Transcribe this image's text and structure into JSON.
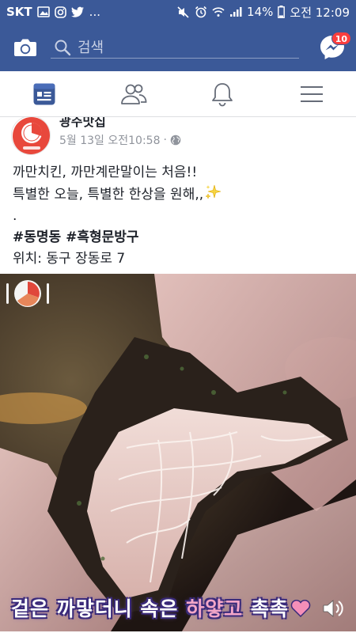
{
  "status_bar": {
    "carrier": "SKT",
    "more": "...",
    "battery": "14%",
    "time": "오전 12:09"
  },
  "header": {
    "search_placeholder": "검색",
    "messenger_badge": "10",
    "brand_color": "#3b5998"
  },
  "tabs": [
    {
      "name": "news-feed",
      "icon": "news-feed-icon",
      "active": true
    },
    {
      "name": "friends",
      "icon": "friends-icon",
      "active": false
    },
    {
      "name": "notifications",
      "icon": "bell-icon",
      "active": false
    },
    {
      "name": "menu",
      "icon": "hamburger-icon",
      "active": false
    }
  ],
  "post": {
    "page_name": "광주맛집",
    "date": "5월 13일 오전10:58",
    "separator": "·",
    "text_lines": [
      "까만치킨, 까만계란말이는 처음!!",
      "특별한 오늘, 특별한 한상을 원해,,",
      "."
    ],
    "hashtags": "#동명동 #흑형문방구",
    "location": "위치: 동구 장동로 7",
    "video_caption_part1": "겉은 까맣더니 속은 ",
    "video_caption_part2": "하얗고",
    "video_caption_part3": " 촉촉"
  }
}
